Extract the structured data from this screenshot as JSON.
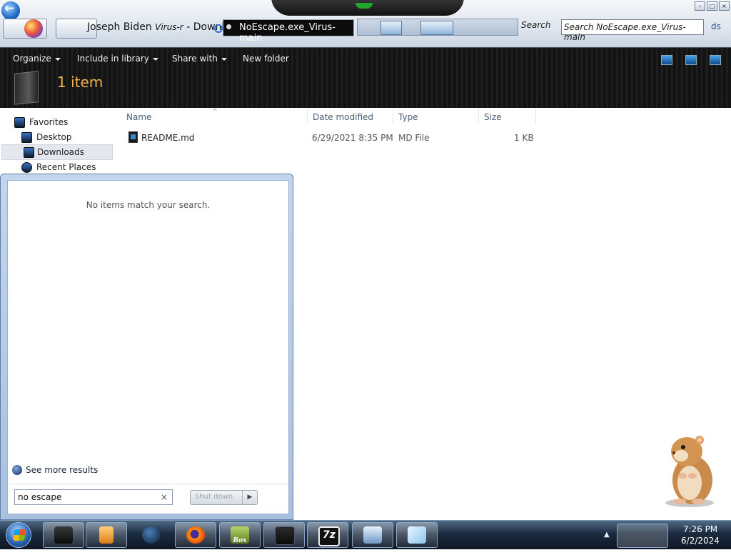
{
  "window": {
    "breadcrumb": [
      "Joseph Biden",
      "Virus-r",
      "Downloads"
    ],
    "current_folder": "NoEscape.exe_Virus-main",
    "search_label": "Search",
    "search_placeholder": "Search NoEscape.exe_Virus-main",
    "search_side_label": "ds"
  },
  "toolbar": {
    "organize": "Organize",
    "include_in_library": "Include in library",
    "share_with": "Share with",
    "new_folder": "New folder"
  },
  "header": {
    "item_count": "1 item"
  },
  "nav": {
    "items": [
      {
        "label": "Favorites",
        "icon": "star-icon"
      },
      {
        "label": "Desktop",
        "icon": "desktop-icon"
      },
      {
        "label": "Downloads",
        "icon": "downloads-icon"
      },
      {
        "label": "Recent Places",
        "icon": "recent-places-icon"
      }
    ]
  },
  "file_list": {
    "columns": [
      "Name",
      "Date modified",
      "Type",
      "Size"
    ],
    "rows": [
      {
        "name": "README.md",
        "date_modified": "6/29/2021 8:35 PM",
        "type": "MD File",
        "size": "1 KB"
      }
    ]
  },
  "start_menu": {
    "no_results": "No items match your search.",
    "see_more": "See more results",
    "search_value": "no escape",
    "clear_label": "×",
    "shutdown_label": "Shut down"
  },
  "taskbar": {
    "items": [
      {
        "name": "taskbar-explorer",
        "icon": "folder-icon"
      },
      {
        "name": "taskbar-media",
        "icon": "media-player-icon"
      },
      {
        "name": "taskbar-dark-orb",
        "icon": "dark-orb-icon"
      },
      {
        "name": "taskbar-firefox",
        "icon": "firefox-icon"
      },
      {
        "name": "taskbar-box-game",
        "icon": "box-game-icon"
      },
      {
        "name": "taskbar-window",
        "icon": "window-icon"
      },
      {
        "name": "taskbar-7zip",
        "icon": "7zip-icon"
      },
      {
        "name": "taskbar-network",
        "icon": "network-icon"
      },
      {
        "name": "taskbar-notepad",
        "icon": "notepad-icon"
      }
    ],
    "sevenzip_label": "7z",
    "box_label": "Box",
    "time": "7:26 PM",
    "date": "6/2/2024"
  }
}
